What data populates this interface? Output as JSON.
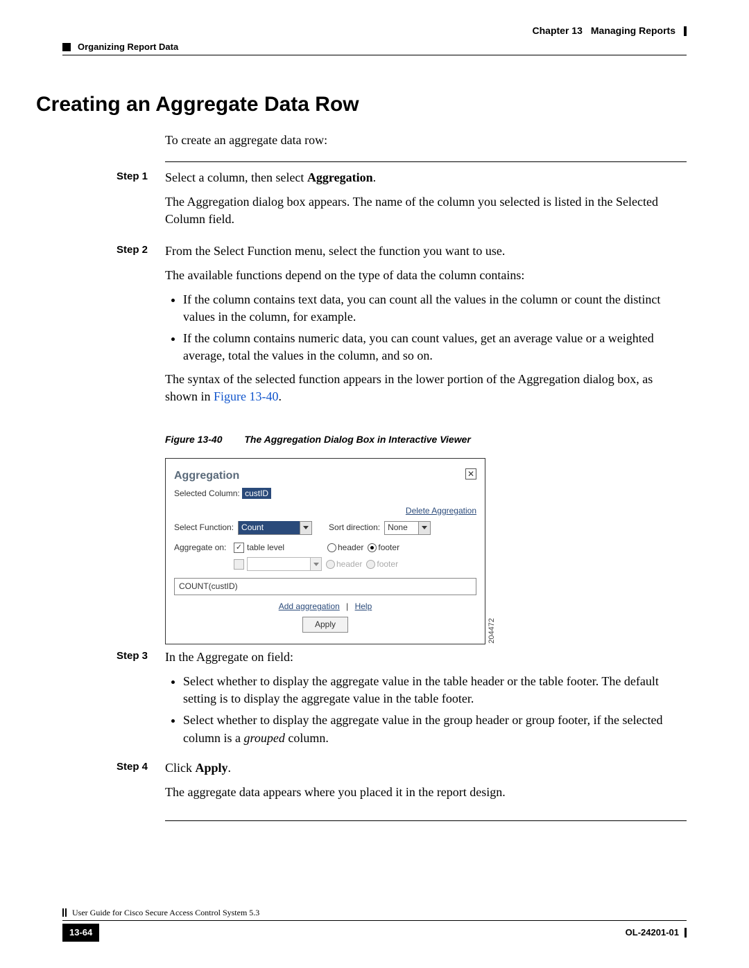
{
  "header": {
    "chapter": "Chapter 13",
    "chapter_title": "Managing Reports",
    "section": "Organizing Report Data"
  },
  "title": "Creating an Aggregate Data Row",
  "intro": "To create an aggregate data row:",
  "steps": {
    "s1": {
      "label": "Step 1",
      "line1_a": "Select a column, then select ",
      "line1_b": "Aggregation",
      "line1_c": ".",
      "line2": "The Aggregation dialog box appears. The name of the column you selected is listed in the Selected Column field."
    },
    "s2": {
      "label": "Step 2",
      "line1": "From the Select Function menu, select the function you want to use.",
      "line2": "The available functions depend on the type of data the column contains:",
      "b1": "If the column contains text data, you can count all the values in the column or count the distinct values in the column, for example.",
      "b2": "If the column contains numeric data, you can count values, get an average value or a weighted average, total the values in the column, and so on.",
      "line3_a": "The syntax of the selected function appears in the lower portion of the Aggregation dialog box, as shown in ",
      "line3_link": "Figure 13-40",
      "line3_c": "."
    },
    "s3": {
      "label": "Step 3",
      "line1": "In the Aggregate on field:",
      "b1": "Select whether to display the aggregate value in the table header or the table footer. The default setting is to display the aggregate value in the table footer.",
      "b2_a": "Select whether to display the aggregate value in the group header or group footer, if the selected column is a ",
      "b2_i": "grouped",
      "b2_c": " column."
    },
    "s4": {
      "label": "Step 4",
      "line1_a": "Click ",
      "line1_b": "Apply",
      "line1_c": ".",
      "line2": "The aggregate data appears where you placed it in the report design."
    }
  },
  "figure": {
    "num": "Figure 13-40",
    "title": "The Aggregation Dialog Box in Interactive Viewer",
    "side_id": "204472"
  },
  "dialog": {
    "title": "Aggregation",
    "selected_col_label": "Selected Column:",
    "selected_col_value": "custID",
    "delete_link": "Delete Aggregation",
    "select_func_label": "Select Function:",
    "select_func_value": "Count",
    "sort_dir_label": "Sort direction:",
    "sort_dir_value": "None",
    "agg_on_label": "Aggregate on:",
    "table_level": "table level",
    "header1": "header",
    "footer1": "footer",
    "header2": "header",
    "footer2": "footer",
    "preview": "COUNT(custID)",
    "add_agg": "Add aggregation",
    "help": "Help",
    "apply": "Apply"
  },
  "footer": {
    "page_num": "13-64",
    "guide": "User Guide for Cisco Secure Access Control System 5.3",
    "doc_id": "OL-24201-01"
  }
}
